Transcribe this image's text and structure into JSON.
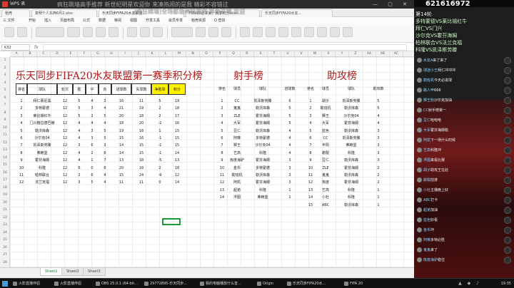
{
  "window": {
    "app_name": "WPS 表",
    "controls": "— ▢ ✕"
  },
  "doc_tabs": [
    "稻壳",
    "复明个人东西6月2.xlsx",
    "乐天同步FIFA20水友联盟...",
    "FIFA20足球第一赛季积分.xlsx",
    "乐天同步FIFA20水友..."
  ],
  "menu": [
    "三 文件",
    "开始",
    "插入",
    "页面布局",
    "公式",
    "数据",
    "审阅",
    "视图",
    "开发工具",
    "会员专享",
    "稻壳资源",
    "Q 查找"
  ],
  "formula_bar": {
    "name_box": "K32",
    "fx": "fx"
  },
  "columns": [
    "A",
    "B",
    "C",
    "D",
    "E",
    "F",
    "G",
    "H",
    "I",
    "J",
    "K",
    "L",
    "M",
    "N",
    "O",
    "P",
    "Q",
    "R",
    "S",
    "T",
    "U",
    "V",
    "W",
    "X",
    "Y",
    "Z",
    "AA",
    "AB",
    "AC"
  ],
  "row_numbers": [
    "1",
    "2",
    "3",
    "4",
    "5",
    "6",
    "7",
    "8",
    "9",
    "10",
    "11",
    "12",
    "13",
    "14",
    "15",
    "16",
    "17",
    "18",
    "19",
    "20",
    "21",
    "22",
    "23",
    "24",
    "25",
    "26",
    "27",
    "28"
  ],
  "standings": {
    "title": "乐天同步FIFA20水友联盟第一赛季积分榜",
    "headers": [
      "排名",
      "球队",
      "轮次",
      "胜",
      "平",
      "负",
      "进球数",
      "失球数",
      "净胜球",
      "积分"
    ],
    "rows": [
      [
        "1",
        "拜仁慕尼黑",
        "12",
        "5",
        "4",
        "3",
        "16",
        "11",
        "5",
        "19"
      ],
      [
        "2",
        "多特蒙德",
        "12",
        "5",
        "3",
        "4",
        "21",
        "19",
        "2",
        "18"
      ],
      [
        "3",
        "莱比锡红牛",
        "12",
        "5",
        "2",
        "5",
        "20",
        "18",
        "2",
        "17"
      ],
      [
        "4",
        "门兴格拉德巴赫",
        "12",
        "4",
        "4",
        "4",
        "18",
        "20",
        "-2",
        "16"
      ],
      [
        "5",
        "勒沃库森",
        "12",
        "4",
        "3",
        "5",
        "19",
        "18",
        "1",
        "15"
      ],
      [
        "6",
        "沙尔克04",
        "12",
        "4",
        "3",
        "5",
        "15",
        "16",
        "-1",
        "15"
      ],
      [
        "7",
        "凯泽斯劳滕",
        "12",
        "3",
        "6",
        "3",
        "14",
        "15",
        "-1",
        "15"
      ],
      [
        "8",
        "弗赖堡",
        "12",
        "4",
        "2",
        "6",
        "14",
        "15",
        "-1",
        "14"
      ],
      [
        "9",
        "霍芬海姆",
        "12",
        "4",
        "1",
        "7",
        "13",
        "18",
        "-5",
        "13"
      ],
      [
        "10",
        "科隆",
        "12",
        "6",
        "0",
        "6",
        "20",
        "18",
        "2",
        "18"
      ],
      [
        "11",
        "柏林联合",
        "12",
        "2",
        "6",
        "4",
        "15",
        "24",
        "-9",
        "12"
      ],
      [
        "12",
        "法兰克福",
        "12",
        "3",
        "5",
        "4",
        "11",
        "11",
        "0",
        "14"
      ]
    ]
  },
  "scorers": {
    "title": "射手榜",
    "headers": [
      "排名",
      "球员",
      "球队",
      "进球数"
    ],
    "rows": [
      [
        "1",
        "CC",
        "凯泽斯劳滕",
        "6"
      ],
      [
        "2",
        "鬼鬼",
        "勒沃库森",
        "5"
      ],
      [
        "3",
        "ZLE",
        "霍芬海姆",
        "5"
      ],
      [
        "4",
        "大军",
        "霍芬海姆",
        "5"
      ],
      [
        "5",
        "豆仁",
        "勒沃库森",
        "4"
      ],
      [
        "6",
        "阿琳",
        "多特蒙德",
        "4"
      ],
      [
        "7",
        "狮王",
        "沙尔克04",
        "4"
      ],
      [
        "8",
        "艺高",
        "科隆",
        "4"
      ],
      [
        "9",
        "炼度海驴",
        "霍芬海姆",
        "3"
      ],
      [
        "10",
        "金币",
        "多特蒙德",
        "3"
      ],
      [
        "11",
        "勒班机",
        "勒沃库森",
        "3"
      ],
      [
        "12",
        "阿凯",
        "霍芬海姆",
        "3"
      ],
      [
        "13",
        "超弟",
        "科隆",
        "1"
      ],
      [
        "14",
        "浮图",
        "弗赖堡",
        "1"
      ]
    ]
  },
  "assists": {
    "title": "助攻榜",
    "headers": [
      "排名",
      "球员",
      "球队",
      "助攻数"
    ],
    "rows": [
      [
        "1",
        "胡子",
        "凯泽斯劳滕",
        "5"
      ],
      [
        "2",
        "勒班机",
        "勒沃库森",
        "5"
      ],
      [
        "3",
        "狮王",
        "沙尔克04",
        "4"
      ],
      [
        "4",
        "大军",
        "霍芬海姆",
        "4"
      ],
      [
        "5",
        "蓝色",
        "勒沃库森",
        "3"
      ],
      [
        "6",
        "CC",
        "凯泽斯劳滕",
        "3"
      ],
      [
        "7",
        "丰阳",
        "弗赖堡",
        "3"
      ],
      [
        "8",
        "鹕裂",
        "科隆",
        "3"
      ],
      [
        "9",
        "豆仁",
        "勒沃库森",
        "3"
      ],
      [
        "10",
        "ZLE",
        "霍芬海姆",
        "2"
      ],
      [
        "11",
        "鬼鬼",
        "勒沃库森",
        "2"
      ],
      [
        "12",
        "炼度",
        "霍芬海姆",
        "2"
      ],
      [
        "13",
        "艺高",
        "科隆",
        "1"
      ],
      [
        "14",
        "小杜",
        "科隆",
        "1"
      ],
      [
        "15",
        "ABC",
        "勒沃库森",
        "1"
      ]
    ]
  },
  "sheet_tabs": [
    "Sheet1",
    "Sheet2",
    "Sheet3"
  ],
  "overlay": {
    "viewer_count": "621616972",
    "danmu": [
      "疯狂跳墙高手推荐  新世纪明星欢迎你  来凑热闹的是我  精彩不容错过",
      "(疯狂跳墙)全场都是神秘嘉宾  等你开播  欢迎"
    ]
  },
  "chat_panel": {
    "header_lines": [
      "第14轮",
      "多特蒙德VS莱比锡红牛",
      "拜仁VS门兴",
      "沙尔克VS霍芬海姆",
      "柏林联合VS法兰克福",
      "科隆VS凯泽斯劳滕"
    ],
    "messages": [
      {
        "user": "水友A",
        "msg": "来了来了"
      },
      {
        "user": "球迷小王",
        "msg": "拜仁冲冲冲"
      },
      {
        "user": "勒班机",
        "msg": "今天必进球"
      },
      {
        "user": "路人甲",
        "msg": "666"
      },
      {
        "user": "狮王粉",
        "msg": "沙尔克加油"
      },
      {
        "user": "CC",
        "msg": "射手榜第一"
      },
      {
        "user": "豆仁",
        "msg": "哈哈哈"
      },
      {
        "user": "大军",
        "msg": "霍芬海姆稳"
      },
      {
        "user": "阿凯",
        "msg": "下一场什么时候"
      },
      {
        "user": "艺高",
        "msg": "科隆冲"
      },
      {
        "user": "浮图",
        "msg": "来看比赛"
      },
      {
        "user": "胡子",
        "msg": "助攻王在此"
      },
      {
        "user": "鹕裂",
        "msg": "前排"
      },
      {
        "user": "小杜",
        "msg": "主播晚上好"
      },
      {
        "user": "ABC",
        "msg": "打卡"
      },
      {
        "user": "超弟",
        "msg": "加油"
      },
      {
        "user": "蓝色",
        "msg": "好看"
      },
      {
        "user": "金币",
        "msg": "冲"
      },
      {
        "user": "阿琳",
        "msg": "多特必胜"
      },
      {
        "user": "鬼鬼",
        "msg": "来了"
      },
      {
        "user": "炼度海驴",
        "msg": "稳住"
      }
    ]
  },
  "taskbar": {
    "items": [
      "火影直播伴侣",
      "火影直播伴侣",
      "OBS 25.0.1 (64-bit...",
      "29772895-乐天同步...",
      "我的电脑播放什么音...",
      "Origin",
      "乐天同步FIFA20水...",
      "FIFA 20"
    ],
    "clock": "19:35"
  }
}
